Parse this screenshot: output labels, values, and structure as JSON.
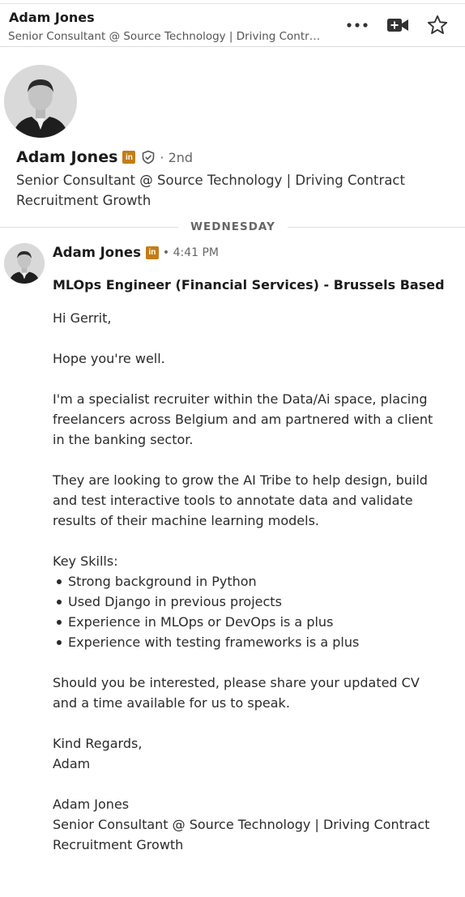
{
  "header": {
    "name": "Adam Jones",
    "subtitle": "Senior Consultant @ Source Technology | Driving Contract Recruitment Growth"
  },
  "profile": {
    "name": "Adam Jones",
    "badge_text": "in",
    "degree": "· 2nd",
    "headline": "Senior Consultant @ Source Technology | Driving Contract Recruitment Growth"
  },
  "divider": {
    "label": "WEDNESDAY"
  },
  "message": {
    "sender": "Adam Jones",
    "badge_text": "in",
    "time": "• 4:41 PM",
    "subject": "MLOps Engineer (Financial Services) - Brussels Based",
    "greeting": "Hi Gerrit,",
    "p1": "Hope you're well.",
    "p2": "I'm a specialist recruiter within the Data/Ai space, placing freelancers across Belgium and am partnered with a client in the banking sector.",
    "p3": "They are looking to grow the AI Tribe to help design, build and test interactive tools to annotate data and validate results of their machine learning models.",
    "skills_heading": "Key Skills:",
    "skills": [
      "Strong background in Python",
      "Used Django in previous projects",
      "Experience in MLOps or DevOps is a plus",
      "Experience with testing frameworks is a plus"
    ],
    "p4": "Should you be interested, please share your updated CV and a time available for us to speak.",
    "signoff_1": "Kind Regards,",
    "signoff_2": "Adam",
    "sig_name": "Adam Jones",
    "sig_title": "Senior Consultant @ Source Technology | Driving Contract Recruitment Growth"
  },
  "icons": {
    "more": "more-horizontal-icon",
    "video": "video-camera-icon",
    "star": "star-icon",
    "verify": "verified-shield-icon"
  },
  "colors": {
    "badge": "#c37d16",
    "divider": "#e0e0e0"
  }
}
